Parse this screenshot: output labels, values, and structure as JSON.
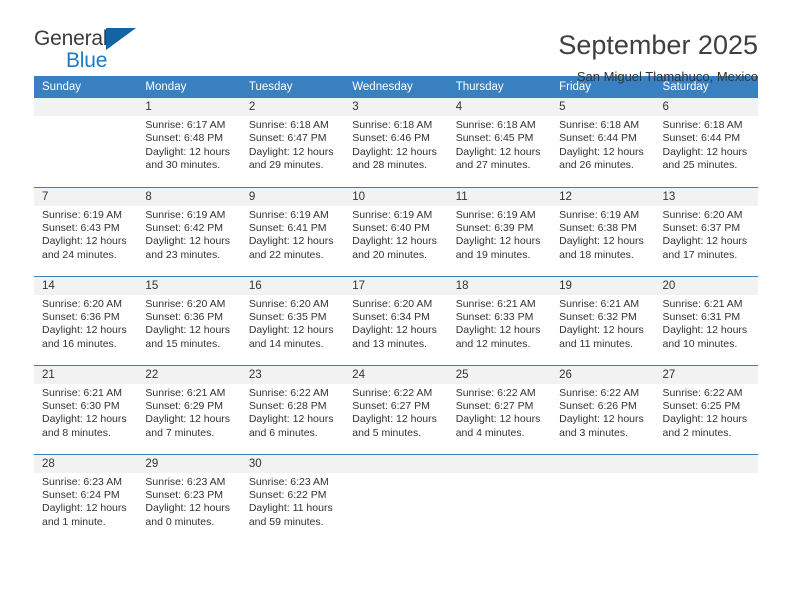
{
  "brand": {
    "name_part1": "General",
    "name_part2": "Blue",
    "triangle_icon": "blue-triangle-logo-mark",
    "accent_color": "#1264a3"
  },
  "header": {
    "title": "September 2025",
    "subtitle": "San Miguel Tlamahuco, Mexico"
  },
  "theme": {
    "header_blue": "#3980c0",
    "daynum_bg": "#f2f2f2",
    "text": "#333333"
  },
  "weekday_headers": [
    "Sunday",
    "Monday",
    "Tuesday",
    "Wednesday",
    "Thursday",
    "Friday",
    "Saturday"
  ],
  "weeks": [
    [
      {
        "day": "",
        "sunrise": "",
        "sunset": "",
        "daylight1": "",
        "daylight2": ""
      },
      {
        "day": "1",
        "sunrise": "Sunrise: 6:17 AM",
        "sunset": "Sunset: 6:48 PM",
        "daylight1": "Daylight: 12 hours",
        "daylight2": "and 30 minutes."
      },
      {
        "day": "2",
        "sunrise": "Sunrise: 6:18 AM",
        "sunset": "Sunset: 6:47 PM",
        "daylight1": "Daylight: 12 hours",
        "daylight2": "and 29 minutes."
      },
      {
        "day": "3",
        "sunrise": "Sunrise: 6:18 AM",
        "sunset": "Sunset: 6:46 PM",
        "daylight1": "Daylight: 12 hours",
        "daylight2": "and 28 minutes."
      },
      {
        "day": "4",
        "sunrise": "Sunrise: 6:18 AM",
        "sunset": "Sunset: 6:45 PM",
        "daylight1": "Daylight: 12 hours",
        "daylight2": "and 27 minutes."
      },
      {
        "day": "5",
        "sunrise": "Sunrise: 6:18 AM",
        "sunset": "Sunset: 6:44 PM",
        "daylight1": "Daylight: 12 hours",
        "daylight2": "and 26 minutes."
      },
      {
        "day": "6",
        "sunrise": "Sunrise: 6:18 AM",
        "sunset": "Sunset: 6:44 PM",
        "daylight1": "Daylight: 12 hours",
        "daylight2": "and 25 minutes."
      }
    ],
    [
      {
        "day": "7",
        "sunrise": "Sunrise: 6:19 AM",
        "sunset": "Sunset: 6:43 PM",
        "daylight1": "Daylight: 12 hours",
        "daylight2": "and 24 minutes."
      },
      {
        "day": "8",
        "sunrise": "Sunrise: 6:19 AM",
        "sunset": "Sunset: 6:42 PM",
        "daylight1": "Daylight: 12 hours",
        "daylight2": "and 23 minutes."
      },
      {
        "day": "9",
        "sunrise": "Sunrise: 6:19 AM",
        "sunset": "Sunset: 6:41 PM",
        "daylight1": "Daylight: 12 hours",
        "daylight2": "and 22 minutes."
      },
      {
        "day": "10",
        "sunrise": "Sunrise: 6:19 AM",
        "sunset": "Sunset: 6:40 PM",
        "daylight1": "Daylight: 12 hours",
        "daylight2": "and 20 minutes."
      },
      {
        "day": "11",
        "sunrise": "Sunrise: 6:19 AM",
        "sunset": "Sunset: 6:39 PM",
        "daylight1": "Daylight: 12 hours",
        "daylight2": "and 19 minutes."
      },
      {
        "day": "12",
        "sunrise": "Sunrise: 6:19 AM",
        "sunset": "Sunset: 6:38 PM",
        "daylight1": "Daylight: 12 hours",
        "daylight2": "and 18 minutes."
      },
      {
        "day": "13",
        "sunrise": "Sunrise: 6:20 AM",
        "sunset": "Sunset: 6:37 PM",
        "daylight1": "Daylight: 12 hours",
        "daylight2": "and 17 minutes."
      }
    ],
    [
      {
        "day": "14",
        "sunrise": "Sunrise: 6:20 AM",
        "sunset": "Sunset: 6:36 PM",
        "daylight1": "Daylight: 12 hours",
        "daylight2": "and 16 minutes."
      },
      {
        "day": "15",
        "sunrise": "Sunrise: 6:20 AM",
        "sunset": "Sunset: 6:36 PM",
        "daylight1": "Daylight: 12 hours",
        "daylight2": "and 15 minutes."
      },
      {
        "day": "16",
        "sunrise": "Sunrise: 6:20 AM",
        "sunset": "Sunset: 6:35 PM",
        "daylight1": "Daylight: 12 hours",
        "daylight2": "and 14 minutes."
      },
      {
        "day": "17",
        "sunrise": "Sunrise: 6:20 AM",
        "sunset": "Sunset: 6:34 PM",
        "daylight1": "Daylight: 12 hours",
        "daylight2": "and 13 minutes."
      },
      {
        "day": "18",
        "sunrise": "Sunrise: 6:21 AM",
        "sunset": "Sunset: 6:33 PM",
        "daylight1": "Daylight: 12 hours",
        "daylight2": "and 12 minutes."
      },
      {
        "day": "19",
        "sunrise": "Sunrise: 6:21 AM",
        "sunset": "Sunset: 6:32 PM",
        "daylight1": "Daylight: 12 hours",
        "daylight2": "and 11 minutes."
      },
      {
        "day": "20",
        "sunrise": "Sunrise: 6:21 AM",
        "sunset": "Sunset: 6:31 PM",
        "daylight1": "Daylight: 12 hours",
        "daylight2": "and 10 minutes."
      }
    ],
    [
      {
        "day": "21",
        "sunrise": "Sunrise: 6:21 AM",
        "sunset": "Sunset: 6:30 PM",
        "daylight1": "Daylight: 12 hours",
        "daylight2": "and 8 minutes."
      },
      {
        "day": "22",
        "sunrise": "Sunrise: 6:21 AM",
        "sunset": "Sunset: 6:29 PM",
        "daylight1": "Daylight: 12 hours",
        "daylight2": "and 7 minutes."
      },
      {
        "day": "23",
        "sunrise": "Sunrise: 6:22 AM",
        "sunset": "Sunset: 6:28 PM",
        "daylight1": "Daylight: 12 hours",
        "daylight2": "and 6 minutes."
      },
      {
        "day": "24",
        "sunrise": "Sunrise: 6:22 AM",
        "sunset": "Sunset: 6:27 PM",
        "daylight1": "Daylight: 12 hours",
        "daylight2": "and 5 minutes."
      },
      {
        "day": "25",
        "sunrise": "Sunrise: 6:22 AM",
        "sunset": "Sunset: 6:27 PM",
        "daylight1": "Daylight: 12 hours",
        "daylight2": "and 4 minutes."
      },
      {
        "day": "26",
        "sunrise": "Sunrise: 6:22 AM",
        "sunset": "Sunset: 6:26 PM",
        "daylight1": "Daylight: 12 hours",
        "daylight2": "and 3 minutes."
      },
      {
        "day": "27",
        "sunrise": "Sunrise: 6:22 AM",
        "sunset": "Sunset: 6:25 PM",
        "daylight1": "Daylight: 12 hours",
        "daylight2": "and 2 minutes."
      }
    ],
    [
      {
        "day": "28",
        "sunrise": "Sunrise: 6:23 AM",
        "sunset": "Sunset: 6:24 PM",
        "daylight1": "Daylight: 12 hours",
        "daylight2": "and 1 minute."
      },
      {
        "day": "29",
        "sunrise": "Sunrise: 6:23 AM",
        "sunset": "Sunset: 6:23 PM",
        "daylight1": "Daylight: 12 hours",
        "daylight2": "and 0 minutes."
      },
      {
        "day": "30",
        "sunrise": "Sunrise: 6:23 AM",
        "sunset": "Sunset: 6:22 PM",
        "daylight1": "Daylight: 11 hours",
        "daylight2": "and 59 minutes."
      },
      {
        "day": "",
        "sunrise": "",
        "sunset": "",
        "daylight1": "",
        "daylight2": ""
      },
      {
        "day": "",
        "sunrise": "",
        "sunset": "",
        "daylight1": "",
        "daylight2": ""
      },
      {
        "day": "",
        "sunrise": "",
        "sunset": "",
        "daylight1": "",
        "daylight2": ""
      },
      {
        "day": "",
        "sunrise": "",
        "sunset": "",
        "daylight1": "",
        "daylight2": ""
      }
    ]
  ]
}
